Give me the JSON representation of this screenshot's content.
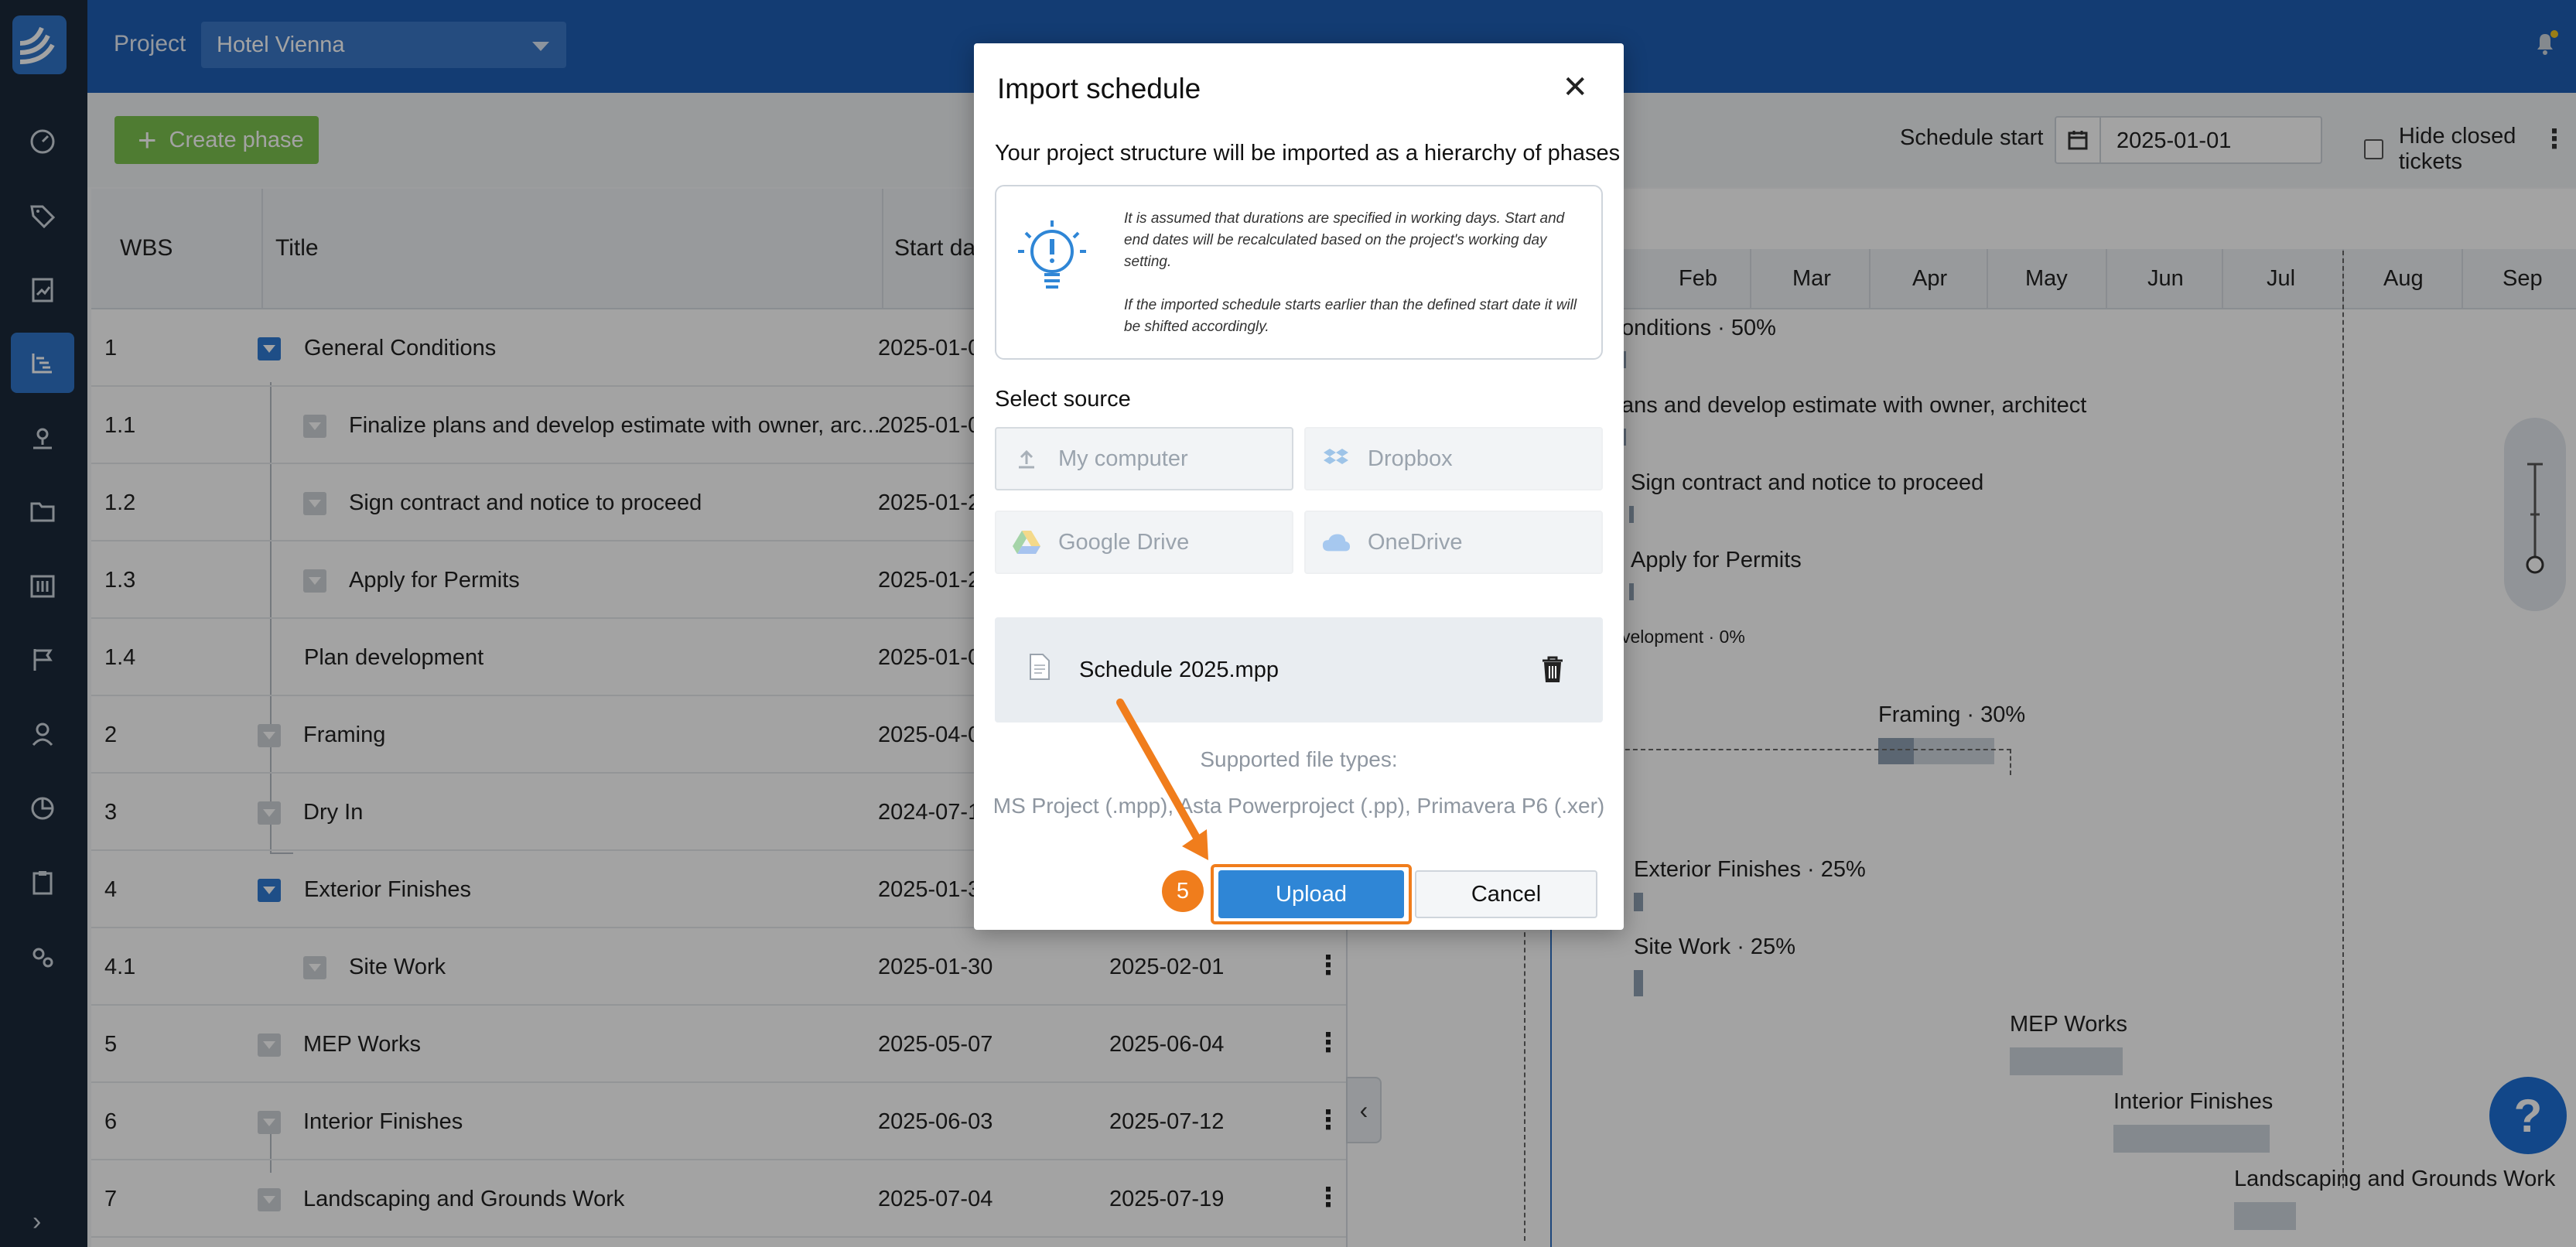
{
  "header": {
    "project_label": "Project",
    "project_value": "Hotel Vienna"
  },
  "toolbar": {
    "create_phase": "Create phase",
    "schedule_start_label": "Schedule start",
    "schedule_start_value": "2025-01-01",
    "hide_closed_label": "Hide closed tickets"
  },
  "table": {
    "headers": {
      "wbs": "WBS",
      "title": "Title",
      "start": "Start dat"
    },
    "rows": [
      {
        "wbs": "1",
        "title": "General Conditions",
        "start": "2025-01-0",
        "end": ""
      },
      {
        "wbs": "1.1",
        "title": "Finalize plans and develop estimate with owner, arc...",
        "start": "2025-01-0",
        "end": ""
      },
      {
        "wbs": "1.2",
        "title": "Sign contract and notice to proceed",
        "start": "2025-01-2",
        "end": ""
      },
      {
        "wbs": "1.3",
        "title": "Apply for Permits",
        "start": "2025-01-2",
        "end": ""
      },
      {
        "wbs": "1.4",
        "title": "Plan development",
        "start": "2025-01-0",
        "end": ""
      },
      {
        "wbs": "2",
        "title": "Framing",
        "start": "2025-04-0",
        "end": ""
      },
      {
        "wbs": "3",
        "title": "Dry In",
        "start": "2024-07-1",
        "end": ""
      },
      {
        "wbs": "4",
        "title": "Exterior Finishes",
        "start": "2025-01-3",
        "end": ""
      },
      {
        "wbs": "4.1",
        "title": "Site Work",
        "start": "2025-01-30",
        "end": "2025-02-01"
      },
      {
        "wbs": "5",
        "title": "MEP Works",
        "start": "2025-05-07",
        "end": "2025-06-04"
      },
      {
        "wbs": "6",
        "title": "Interior Finishes",
        "start": "2025-06-03",
        "end": "2025-07-12"
      },
      {
        "wbs": "7",
        "title": "Landscaping and Grounds Work",
        "start": "2025-07-04",
        "end": "2025-07-19"
      }
    ]
  },
  "gantt": {
    "months": [
      "Feb",
      "Mar",
      "Apr",
      "May",
      "Jun",
      "Jul",
      "Aug",
      "Sep"
    ],
    "labels": {
      "general": "onditions · 50%",
      "finalize": "ans and develop estimate with owner, architect",
      "sign": "Sign contract and notice to proceed",
      "permits": "Apply for Permits",
      "plan": "velopment · 0%",
      "framing": "Framing · 30%",
      "exterior": "Exterior Finishes · 25%",
      "site": "Site Work · 25%",
      "mep": "MEP Works",
      "interior": "Interior Finishes",
      "landscaping": "Landscaping and Grounds Work"
    }
  },
  "modal": {
    "title": "Import schedule",
    "subtitle": "Your project structure will be imported as a hierarchy of phases",
    "info_1": "It is assumed that durations are specified in working days. Start and end dates will be recalculated based on the project's working day setting.",
    "info_2": "If the imported schedule starts earlier than the defined start date it will be shifted accordingly.",
    "select_source": "Select source",
    "sources": [
      "My computer",
      "Dropbox",
      "Google Drive",
      "OneDrive"
    ],
    "file_name": "Schedule 2025.mpp",
    "supported_label": "Supported file types:",
    "supported_types": "MS Project (.mpp), Asta Powerproject (.pp), Primavera P6 (.xer)",
    "upload": "Upload",
    "cancel": "Cancel",
    "step": "5"
  },
  "help": "?",
  "colors": {
    "accent": "#2f86d6",
    "highlight": "#f07d1c",
    "topbar": "#1f5fb5",
    "create": "#7cc24f"
  }
}
